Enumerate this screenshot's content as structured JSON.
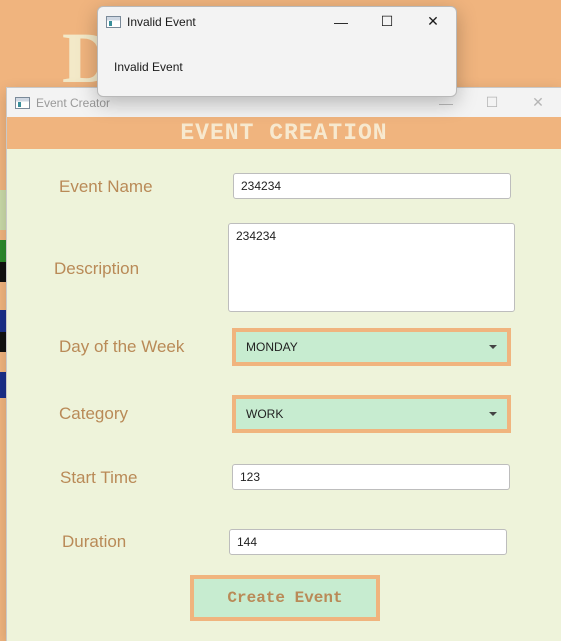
{
  "background": {
    "letter": "D"
  },
  "event_creator": {
    "window_title": "Event Creator",
    "controls": {
      "minimize": "—",
      "maximize": "☐",
      "close": "✕"
    },
    "banner": "EVENT CREATION",
    "fields": {
      "event_name": {
        "label": "Event Name",
        "value": "234234"
      },
      "description": {
        "label": "Description",
        "value": "234234"
      },
      "day_of_week": {
        "label": "Day of the Week",
        "value": "MONDAY"
      },
      "category": {
        "label": "Category",
        "value": "WORK"
      },
      "start_time": {
        "label": "Start Time",
        "value": "123"
      },
      "duration": {
        "label": "Duration",
        "value": "144"
      }
    },
    "create_button": "Create Event"
  },
  "dialog": {
    "title": "Invalid Event",
    "message": "Invalid Event",
    "controls": {
      "minimize": "—",
      "maximize": "☐",
      "close": "✕"
    }
  },
  "colors": {
    "accent": "#f0b47e",
    "form_bg": "#eef3da",
    "combo_bg": "#c7ecd0",
    "label_text": "#b98a57"
  }
}
